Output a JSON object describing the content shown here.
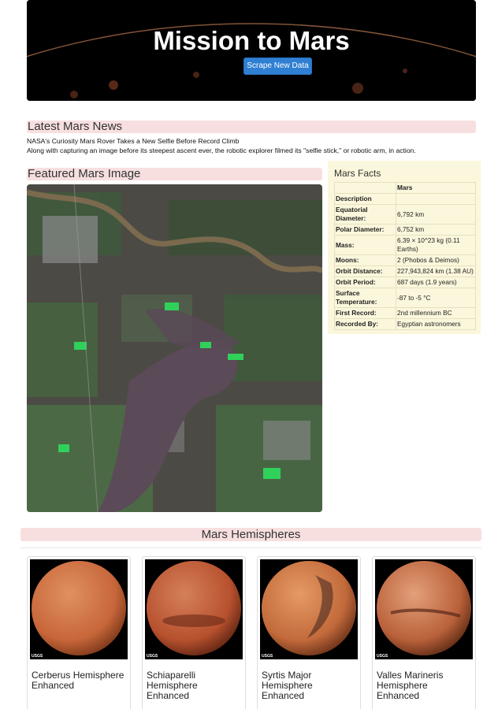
{
  "header": {
    "title": "Mission to Mars",
    "scrape_button": "Scrape New Data"
  },
  "news": {
    "section_title": "Latest Mars News",
    "headline": "NASA's Curiosity Mars Rover Takes a New Selfie Before Record Climb",
    "teaser": "Along with capturing an image before its steepest ascent ever, the robotic explorer filmed its \"selfie stick,\" or robotic arm, in action."
  },
  "featured": {
    "section_title": "Featured Mars Image"
  },
  "facts": {
    "title": "Mars Facts",
    "column_header": "Mars",
    "header_label": "Description",
    "rows": [
      {
        "k": "Equatorial Diameter:",
        "v": "6,792 km"
      },
      {
        "k": "Polar Diameter:",
        "v": "6,752 km"
      },
      {
        "k": "Mass:",
        "v": "6.39 × 10^23 kg (0.11 Earths)"
      },
      {
        "k": "Moons:",
        "v": "2 (Phobos & Deimos)"
      },
      {
        "k": "Orbit Distance:",
        "v": "227,943,824 km (1.38 AU)"
      },
      {
        "k": "Orbit Period:",
        "v": "687 days (1.9 years)"
      },
      {
        "k": "Surface Temperature:",
        "v": "-87 to -5 °C"
      },
      {
        "k": "First Record:",
        "v": "2nd millennium BC"
      },
      {
        "k": "Recorded By:",
        "v": "Egyptian astronomers"
      }
    ]
  },
  "hemispheres": {
    "section_title": "Mars Hemispheres",
    "items": [
      {
        "title": "Cerberus Hemisphere Enhanced",
        "color": "#c7663a"
      },
      {
        "title": "Schiaparelli Hemisphere Enhanced",
        "color": "#b7512e"
      },
      {
        "title": "Syrtis Major Hemisphere Enhanced",
        "color": "#c26a3b"
      },
      {
        "title": "Valles Marineris Hemisphere Enhanced",
        "color": "#b9613a"
      }
    ],
    "logo_text": "USGS"
  }
}
